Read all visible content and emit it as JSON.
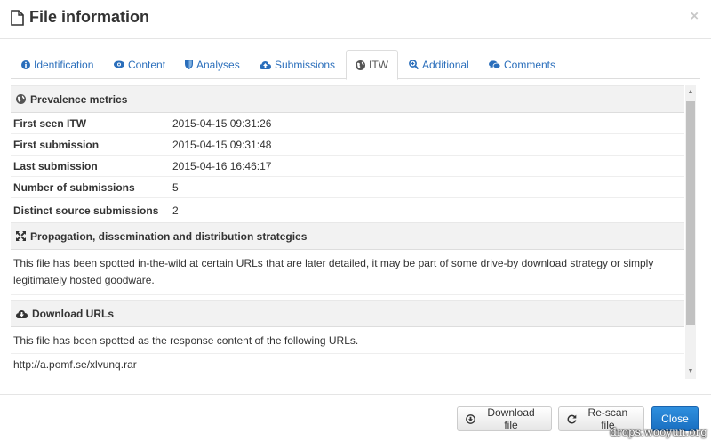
{
  "modal": {
    "title": "File information",
    "close_label": "×"
  },
  "tabs": [
    {
      "label": "Identification",
      "icon": "info-icon"
    },
    {
      "label": "Content",
      "icon": "eye-icon"
    },
    {
      "label": "Analyses",
      "icon": "shield-icon"
    },
    {
      "label": "Submissions",
      "icon": "cloud-upload-icon"
    },
    {
      "label": "ITW",
      "icon": "globe-icon",
      "active": true
    },
    {
      "label": "Additional",
      "icon": "zoom-icon"
    },
    {
      "label": "Comments",
      "icon": "comments-icon"
    }
  ],
  "prevalence": {
    "heading": "Prevalence metrics",
    "rows": [
      {
        "key": "First seen ITW",
        "value": "2015-04-15 09:31:26"
      },
      {
        "key": "First submission",
        "value": "2015-04-15 09:31:48"
      },
      {
        "key": "Last submission",
        "value": "2015-04-16 16:46:17"
      },
      {
        "key": "Number of submissions",
        "value": "5"
      },
      {
        "key": "Distinct source submissions",
        "value": "2"
      }
    ]
  },
  "propagation": {
    "heading": "Propagation, dissemination and distribution strategies",
    "text": "This file has been spotted in-the-wild at certain URLs that are later detailed, it may be part of some drive-by download strategy or simply legitimately hosted goodware."
  },
  "download_urls": {
    "heading": "Download URLs",
    "text": "This file has been spotted as the response content of the following URLs.",
    "urls": [
      "http://a.pomf.se/xlvunq.rar"
    ]
  },
  "footer": {
    "download_label": "Download file",
    "rescan_label": "Re-scan file",
    "close_label": "Close"
  },
  "watermark": "drops.wooyun.org",
  "colors": {
    "link": "#2a6ebb",
    "primary": "#1a6fc1",
    "section_bg": "#f2f2f2"
  }
}
